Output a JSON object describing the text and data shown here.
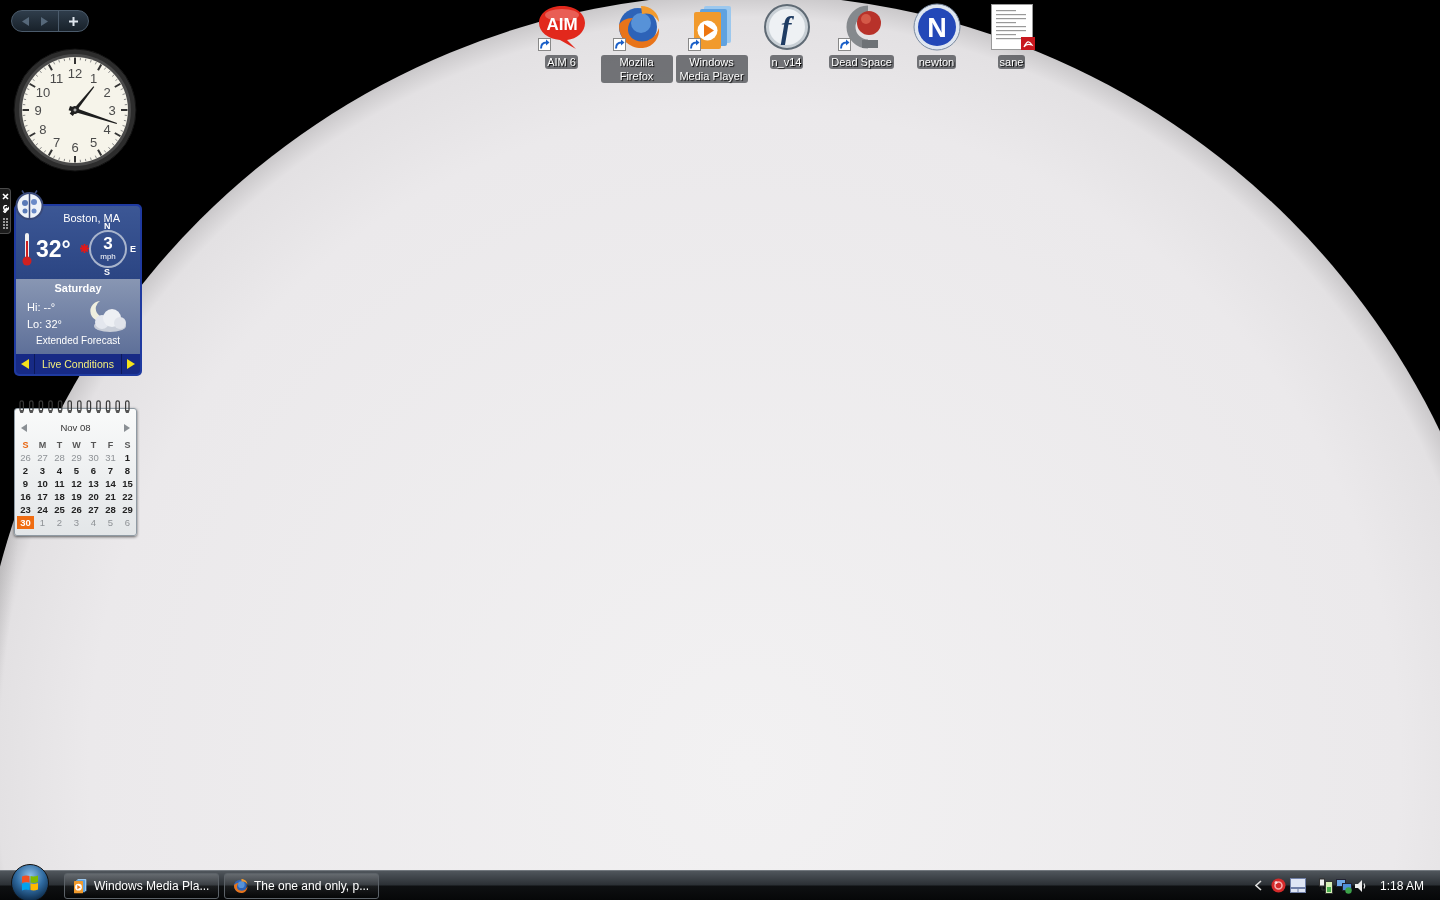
{
  "sidebar_bar": {
    "buttons": [
      {
        "kind": "previous",
        "disabled": true
      },
      {
        "kind": "next",
        "disabled": true
      },
      {
        "kind": "add",
        "disabled": false
      }
    ]
  },
  "clock": {
    "numerals": [
      "11",
      "12",
      "1",
      "10",
      "2",
      "9",
      "3",
      "8",
      "4",
      "7",
      "5",
      "6"
    ]
  },
  "weather": {
    "toolbar": [
      {
        "kind": "close"
      },
      {
        "kind": "options"
      },
      {
        "kind": "drag"
      }
    ],
    "location": "Boston, MA",
    "temperature": "32°",
    "wind": {
      "speed": "3",
      "unit": "mph",
      "compass": [
        {
          "kind": "north",
          "label": "N"
        },
        {
          "kind": "east",
          "label": "E"
        },
        {
          "kind": "south",
          "label": "S"
        }
      ]
    },
    "day": "Saturday",
    "high": "Hi: --°",
    "low": "Lo: 32°",
    "extended": "Extended Forecast",
    "view": "Live Conditions"
  },
  "calendar": {
    "month": "Nov 08",
    "weekdays": [
      {
        "label": "S",
        "today": true
      },
      {
        "label": "M",
        "today": false
      },
      {
        "label": "T",
        "today": false
      },
      {
        "label": "W",
        "today": false
      },
      {
        "label": "T",
        "today": false
      },
      {
        "label": "F",
        "today": false
      },
      {
        "label": "S",
        "today": false
      }
    ],
    "weeks": [
      [
        {
          "label": "26",
          "other_month": true,
          "today": false
        },
        {
          "label": "27",
          "other_month": true,
          "today": false
        },
        {
          "label": "28",
          "other_month": true,
          "today": false
        },
        {
          "label": "29",
          "other_month": true,
          "today": false
        },
        {
          "label": "30",
          "other_month": true,
          "today": false
        },
        {
          "label": "31",
          "other_month": true,
          "today": false
        },
        {
          "label": "1",
          "other_month": false,
          "today": false
        }
      ],
      [
        {
          "label": "2",
          "other_month": false,
          "today": false
        },
        {
          "label": "3",
          "other_month": false,
          "today": false
        },
        {
          "label": "4",
          "other_month": false,
          "today": false
        },
        {
          "label": "5",
          "other_month": false,
          "today": false
        },
        {
          "label": "6",
          "other_month": false,
          "today": false
        },
        {
          "label": "7",
          "other_month": false,
          "today": false
        },
        {
          "label": "8",
          "other_month": false,
          "today": false
        }
      ],
      [
        {
          "label": "9",
          "other_month": false,
          "today": false
        },
        {
          "label": "10",
          "other_month": false,
          "today": false
        },
        {
          "label": "11",
          "other_month": false,
          "today": false
        },
        {
          "label": "12",
          "other_month": false,
          "today": false
        },
        {
          "label": "13",
          "other_month": false,
          "today": false
        },
        {
          "label": "14",
          "other_month": false,
          "today": false
        },
        {
          "label": "15",
          "other_month": false,
          "today": false
        }
      ],
      [
        {
          "label": "16",
          "other_month": false,
          "today": false
        },
        {
          "label": "17",
          "other_month": false,
          "today": false
        },
        {
          "label": "18",
          "other_month": false,
          "today": false
        },
        {
          "label": "19",
          "other_month": false,
          "today": false
        },
        {
          "label": "20",
          "other_month": false,
          "today": false
        },
        {
          "label": "21",
          "other_month": false,
          "today": false
        },
        {
          "label": "22",
          "other_month": false,
          "today": false
        }
      ],
      [
        {
          "label": "23",
          "other_month": false,
          "today": false
        },
        {
          "label": "24",
          "other_month": false,
          "today": false
        },
        {
          "label": "25",
          "other_month": false,
          "today": false
        },
        {
          "label": "26",
          "other_month": false,
          "today": false
        },
        {
          "label": "27",
          "other_month": false,
          "today": false
        },
        {
          "label": "28",
          "other_month": false,
          "today": false
        },
        {
          "label": "29",
          "other_month": false,
          "today": false
        }
      ],
      [
        {
          "label": "30",
          "other_month": false,
          "today": true
        },
        {
          "label": "1",
          "other_month": true,
          "today": false
        },
        {
          "label": "2",
          "other_month": true,
          "today": false
        },
        {
          "label": "3",
          "other_month": true,
          "today": false
        },
        {
          "label": "4",
          "other_month": true,
          "today": false
        },
        {
          "label": "5",
          "other_month": true,
          "today": false
        },
        {
          "label": "6",
          "other_month": true,
          "today": false
        }
      ]
    ]
  },
  "icons": [
    {
      "label": "AIM 6",
      "kind": "aim",
      "logo_text": "AIM",
      "shortcut": true
    },
    {
      "label": "Mozilla Firefox",
      "kind": "browser",
      "shortcut": true
    },
    {
      "label": "Windows Media Player",
      "kind": "media",
      "shortcut": true
    },
    {
      "label": "n_v14",
      "kind": "flash",
      "logo_text": "f",
      "shortcut": false
    },
    {
      "label": "Dead Space",
      "kind": "game",
      "shortcut": true
    },
    {
      "label": "newton",
      "kind": "letter",
      "logo_text": "N",
      "shortcut": false
    },
    {
      "label": "sane",
      "kind": "pdf",
      "shortcut": false
    }
  ],
  "taskbar": {
    "buttons": [
      {
        "label": "Windows Media Pla...",
        "kind": "media",
        "selected": false
      },
      {
        "label": "The one and only, p...",
        "kind": "browser",
        "selected": false
      }
    ],
    "tray": [
      {
        "kind": "show-hidden"
      },
      {
        "kind": "disc"
      },
      {
        "kind": "screen"
      },
      {
        "kind": "power"
      },
      {
        "kind": "network"
      },
      {
        "kind": "volume"
      }
    ],
    "time": "1:18 AM"
  }
}
